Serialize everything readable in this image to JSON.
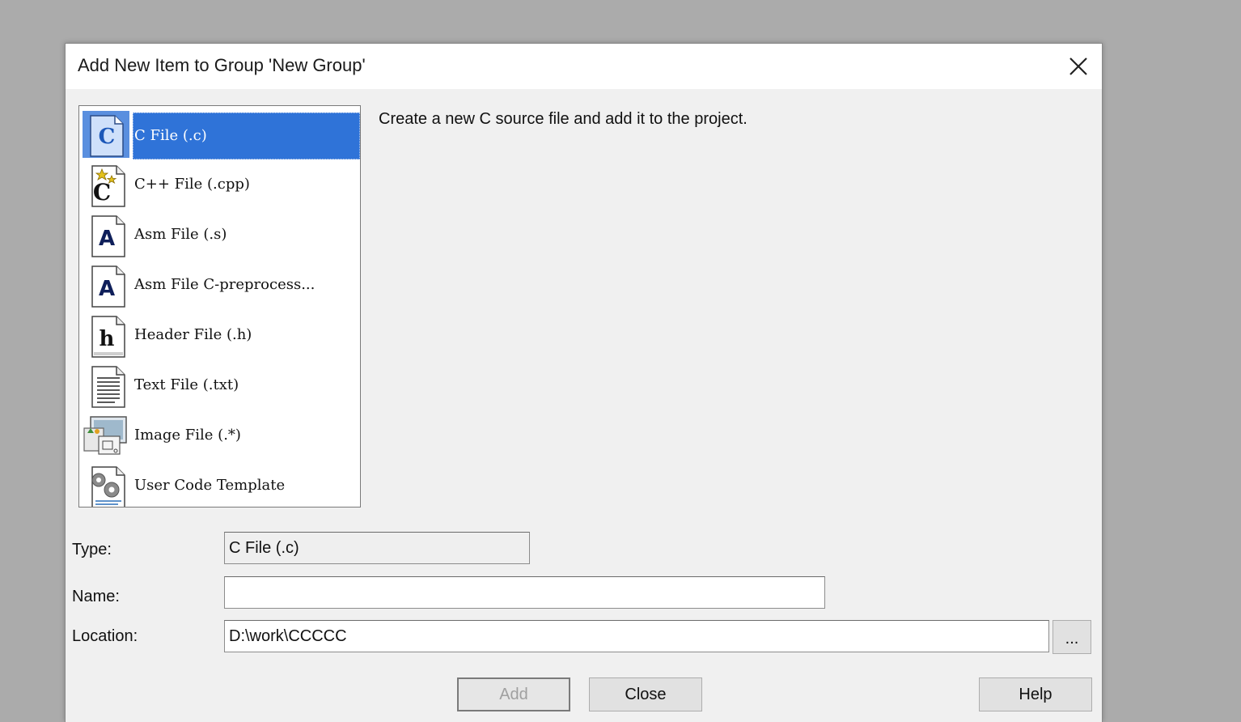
{
  "dialog": {
    "title": "Add New Item to Group 'New Group'",
    "close_icon": "close-icon"
  },
  "items": [
    {
      "label": "C File (.c)",
      "icon": "c-file-icon",
      "selected": true
    },
    {
      "label": "C++ File (.cpp)",
      "icon": "cpp-file-icon",
      "selected": false
    },
    {
      "label": "Asm File (.s)",
      "icon": "asm-file-icon",
      "selected": false
    },
    {
      "label": "Asm File C-preprocess...",
      "icon": "asm-preprocess-file-icon",
      "selected": false
    },
    {
      "label": "Header File (.h)",
      "icon": "header-file-icon",
      "selected": false
    },
    {
      "label": "Text File (.txt)",
      "icon": "text-file-icon",
      "selected": false
    },
    {
      "label": "Image File (.*)",
      "icon": "image-file-icon",
      "selected": false
    },
    {
      "label": "User Code Template",
      "icon": "user-code-template-icon",
      "selected": false
    }
  ],
  "description": "Create a new C source file and add it to the project.",
  "form": {
    "type_label": "Type:",
    "type_value": "C File (.c)",
    "name_label": "Name:",
    "name_value": "",
    "location_label": "Location:",
    "location_value": "D:\\work\\CCCCC",
    "browse_label": "..."
  },
  "buttons": {
    "add": "Add",
    "close": "Close",
    "help": "Help"
  },
  "colors": {
    "selection": "#2f73d8",
    "background": "#ababab",
    "dialog_bg": "#f0f0f0"
  }
}
